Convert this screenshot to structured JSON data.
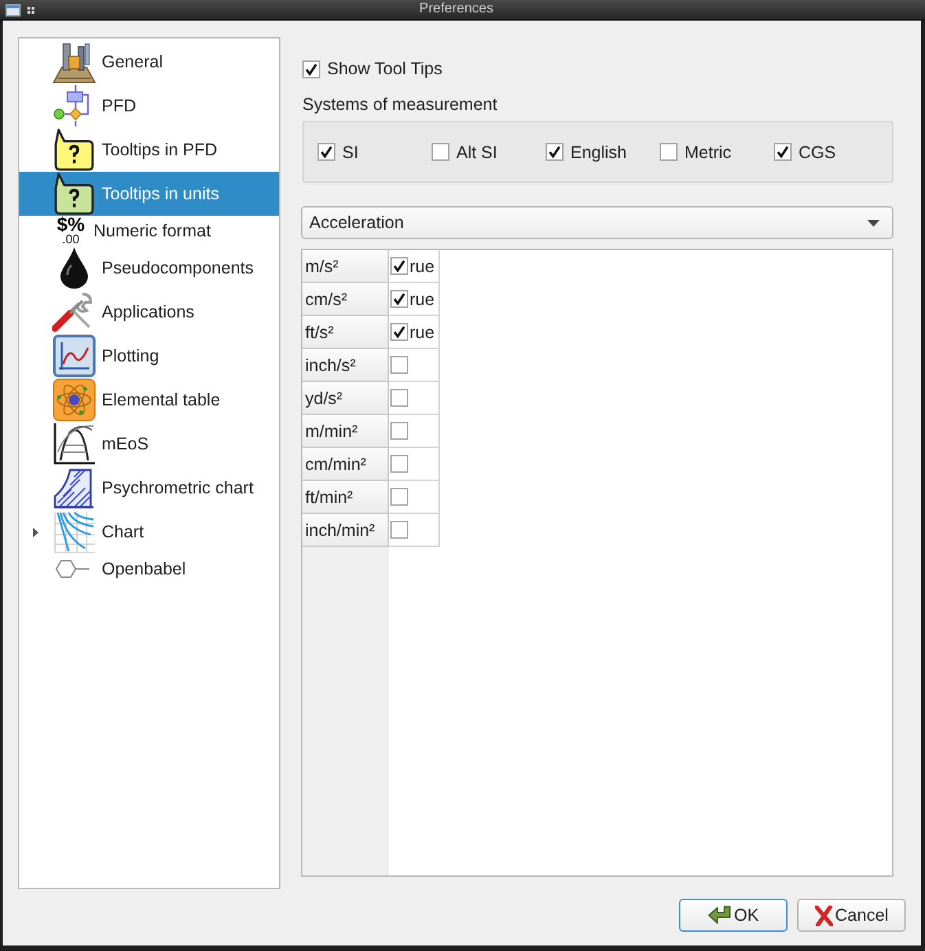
{
  "window": {
    "title": "Preferences"
  },
  "sidebar": {
    "items": [
      {
        "label": "General",
        "selected": false,
        "collapsed": false
      },
      {
        "label": "PFD",
        "selected": false,
        "collapsed": false
      },
      {
        "label": "Tooltips in PFD",
        "selected": false,
        "collapsed": false
      },
      {
        "label": "Tooltips in units",
        "selected": true,
        "collapsed": false
      },
      {
        "label": "Numeric format",
        "icon_text": "$%",
        "icon_subtext": ".00",
        "selected": false,
        "collapsed": false
      },
      {
        "label": "Pseudocomponents",
        "selected": false,
        "collapsed": false
      },
      {
        "label": "Applications",
        "selected": false,
        "collapsed": false
      },
      {
        "label": "Plotting",
        "selected": false,
        "collapsed": false
      },
      {
        "label": "Elemental table",
        "selected": false,
        "collapsed": false
      },
      {
        "label": "mEoS",
        "selected": false,
        "collapsed": false
      },
      {
        "label": "Psychrometric chart",
        "selected": false,
        "collapsed": false
      },
      {
        "label": "Chart",
        "selected": false,
        "collapsed": true
      },
      {
        "label": "Openbabel",
        "selected": false,
        "collapsed": false
      }
    ]
  },
  "show_tool_tips": {
    "label": "Show Tool Tips",
    "checked": true
  },
  "systems_of_measurement": {
    "title": "Systems of measurement",
    "options": [
      {
        "label": "SI",
        "checked": true
      },
      {
        "label": "Alt SI",
        "checked": false
      },
      {
        "label": "English",
        "checked": true
      },
      {
        "label": "Metric",
        "checked": false
      },
      {
        "label": "CGS",
        "checked": true
      }
    ]
  },
  "unit_category": {
    "value": "Acceleration"
  },
  "units_table": {
    "rows": [
      {
        "unit": "m/s²",
        "checked": true,
        "value": "rue"
      },
      {
        "unit": "cm/s²",
        "checked": true,
        "value": "rue"
      },
      {
        "unit": "ft/s²",
        "checked": true,
        "value": "rue"
      },
      {
        "unit": "inch/s²",
        "checked": false
      },
      {
        "unit": "yd/s²",
        "checked": false
      },
      {
        "unit": "m/min²",
        "checked": false
      },
      {
        "unit": "cm/min²",
        "checked": false
      },
      {
        "unit": "ft/min²",
        "checked": false
      },
      {
        "unit": "inch/min²",
        "checked": false
      }
    ]
  },
  "buttons": [
    {
      "label": "OK",
      "kind": "ok",
      "default": true
    },
    {
      "label": "Cancel",
      "kind": "cancel",
      "default": false
    }
  ]
}
